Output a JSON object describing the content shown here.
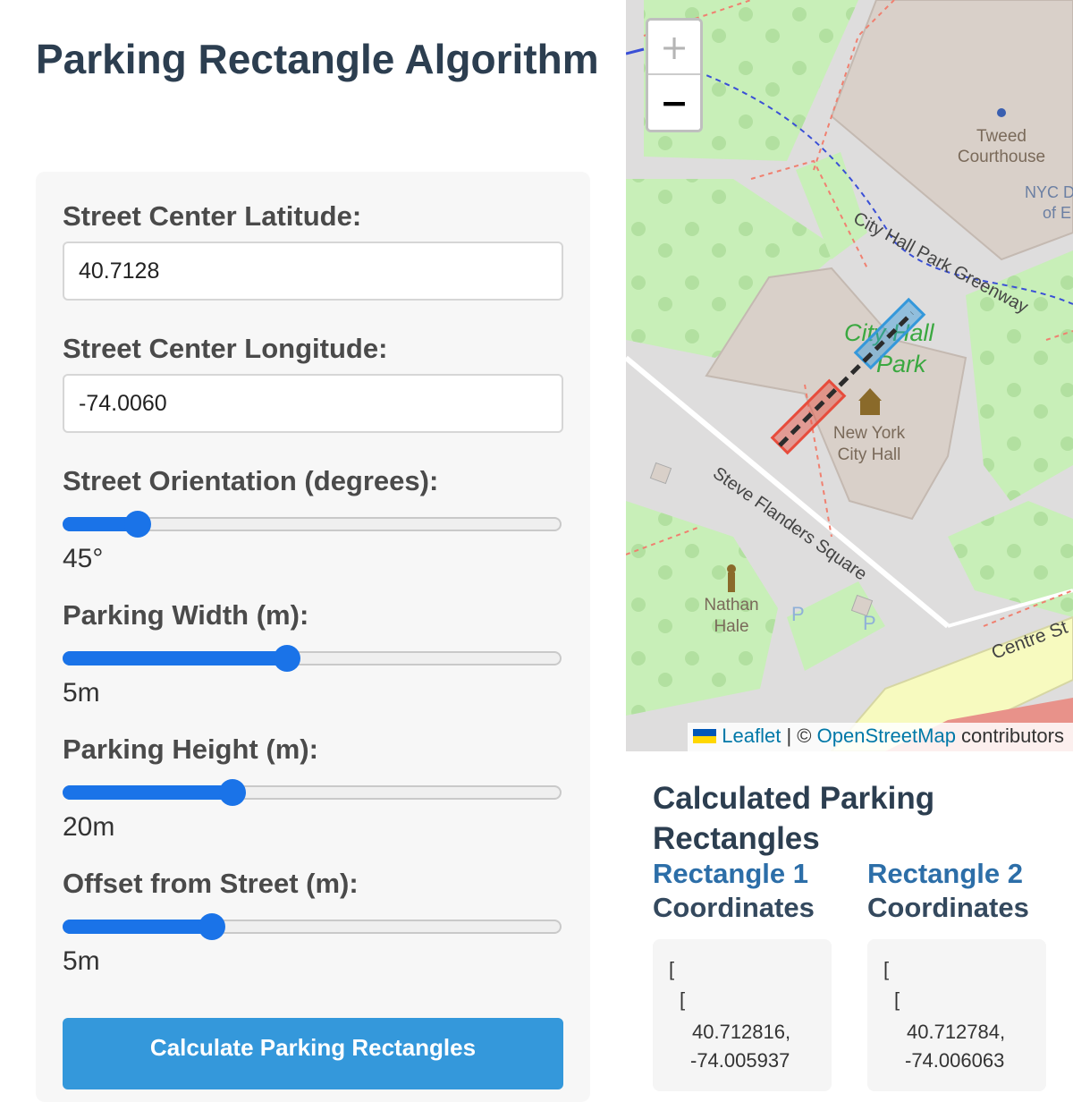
{
  "page": {
    "title": "Parking Rectangle Algorithm"
  },
  "form": {
    "latitude": {
      "label": "Street Center Latitude:",
      "value": "40.7128"
    },
    "longitude": {
      "label": "Street Center Longitude:",
      "value": "-74.0060"
    },
    "orientation": {
      "label": "Street Orientation (degrees):",
      "display": "45°",
      "level": 0.15
    },
    "width": {
      "label": "Parking Width (m):",
      "display": "5m",
      "level": 0.45
    },
    "height": {
      "label": "Parking Height (m):",
      "display": "20m",
      "level": 0.34
    },
    "offset": {
      "label": "Offset from Street (m):",
      "display": "5m",
      "level": 0.3
    },
    "button_label": "Calculate Parking Rectangles"
  },
  "map": {
    "zoom_in": "+",
    "zoom_out": "−",
    "labels": {
      "tweed": "Tweed",
      "courthouse": "Courthouse",
      "nyc_d": "NYC D",
      "of_e": "of E",
      "greenway": "City Hall Park Greenway",
      "park_city": "City Hall",
      "park_park": "Park",
      "city_hall_1": "New York",
      "city_hall_2": "City Hall",
      "square": "Steve Flanders Square",
      "nathan": "Nathan",
      "hale": "Hale",
      "centre": "Centre St",
      "parking_p1": "P",
      "parking_p2": "P"
    },
    "attribution": {
      "leaflet": "Leaflet",
      "separator": " | © ",
      "osm": "OpenStreetMap",
      "suffix": " contributors"
    },
    "colors": {
      "rect1": "#e74c3c",
      "rect2": "#3498db",
      "street": "#2b2b2b",
      "park": "#c8efb8",
      "building": "#d9d0c9"
    }
  },
  "results": {
    "title": "Calculated Parking Rectangles",
    "rect1": {
      "title_1": "Rectangle 1",
      "title_2": "Coordinates",
      "open1": "[",
      "open2": "[",
      "lat": "40.712816,",
      "lng": "-74.005937"
    },
    "rect2": {
      "title_1": "Rectangle 2",
      "title_2": "Coordinates",
      "open1": "[",
      "open2": "[",
      "lat": "40.712784,",
      "lng": "-74.006063"
    }
  }
}
